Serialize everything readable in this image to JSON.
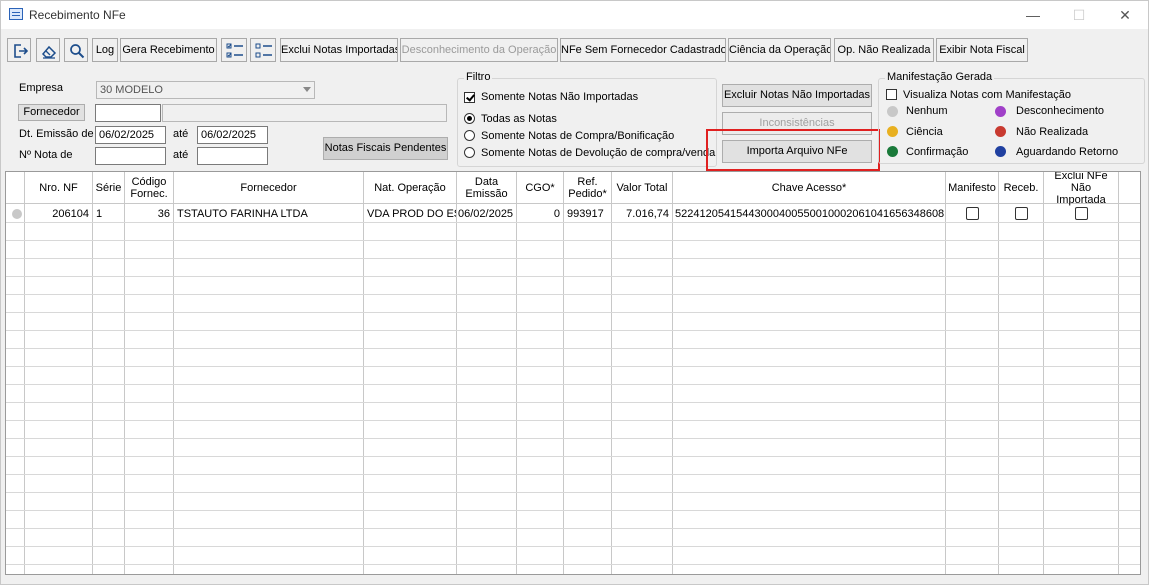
{
  "window": {
    "title": "Recebimento NFe",
    "minimize": "—",
    "maximize": "☐",
    "close": "✕"
  },
  "toolbar": {
    "exit_icon": "exit-icon",
    "clear_icon": "eraser-icon",
    "search_icon": "search-icon",
    "log": "Log",
    "gera_recebimento": "Gera Recebimento",
    "check_all_icon": "check-list-icon",
    "uncheck_all_icon": "uncheck-list-icon",
    "exclui_notas": "Exclui Notas Importadas",
    "desconhecimento": "Desconhecimento da Operação",
    "nfe_sem_fornecedor": "NFe Sem Fornecedor Cadastrado",
    "ciencia": "Ciência da Operação",
    "op_nao_realizada": "Op. Não Realizada",
    "exibir_nota": "Exibir Nota Fiscal"
  },
  "form": {
    "empresa_label": "Empresa",
    "empresa_value": "30 MODELO",
    "fornecedor_button": "Fornecedor",
    "fornecedor_code": "",
    "fornecedor_name": "",
    "dt_emissao_label": "Dt. Emissão de",
    "dt_emissao_from": "06/02/2025",
    "ate1": "até",
    "dt_emissao_to": "06/02/2025",
    "nota_label": "Nº Nota de",
    "nota_from": "",
    "ate2": "até",
    "nota_to": "",
    "notas_pendentes": "Notas Fiscais Pendentes"
  },
  "filtro": {
    "title": "Filtro",
    "somente_nao_importadas": "Somente Notas Não Importadas",
    "somente_nao_importadas_checked": true,
    "options": [
      "Todas as Notas",
      "Somente Notas de Compra/Bonificação",
      "Somente Notas de Devolução de compra/venda"
    ],
    "selected": 0
  },
  "actions": {
    "excluir_nao_importadas": "Excluir Notas Não Importadas",
    "inconsistencias": "Inconsistências",
    "importa_arquivo": "Importa Arquivo NFe"
  },
  "manifestacao": {
    "title": "Manifestação Gerada",
    "visualiza": "Visualiza Notas com Manifestação",
    "legend": [
      {
        "label": "Nenhum",
        "color": "#c8c8c8"
      },
      {
        "label": "Desconhecimento",
        "color": "#a040c8"
      },
      {
        "label": "Ciência",
        "color": "#e8b020"
      },
      {
        "label": "Não Realizada",
        "color": "#c83a30"
      },
      {
        "label": "Confirmação",
        "color": "#1a7a3a"
      },
      {
        "label": "Aguardando Retorno",
        "color": "#2040a0"
      }
    ]
  },
  "grid": {
    "headers": {
      "nro_nf": "Nro. NF",
      "serie": "Série",
      "codigo_fornec": "Código Fornec.",
      "fornecedor": "Fornecedor",
      "nat_operacao": "Nat. Operação",
      "data_emissao": "Data Emissão",
      "cgo": "CGO*",
      "ref_pedido": "Ref. Pedido*",
      "valor_total": "Valor Total",
      "chave_acesso": "Chave Acesso*",
      "manifesto": "Manifesto",
      "receb": "Receb.",
      "exclui_nfe": "Exclui NFe Não Importada"
    },
    "rows": [
      {
        "nro_nf": "206104",
        "serie": "1",
        "codigo_fornec": "36",
        "fornecedor": "TSTAUTO FARINHA LTDA",
        "nat_operacao": "VDA PROD DO ES",
        "data_emissao": "06/02/2025",
        "cgo": "0",
        "ref_pedido": "993917",
        "valor_total": "7.016,74",
        "chave_acesso": "52241205415443000400550010002061041656348608"
      }
    ]
  }
}
